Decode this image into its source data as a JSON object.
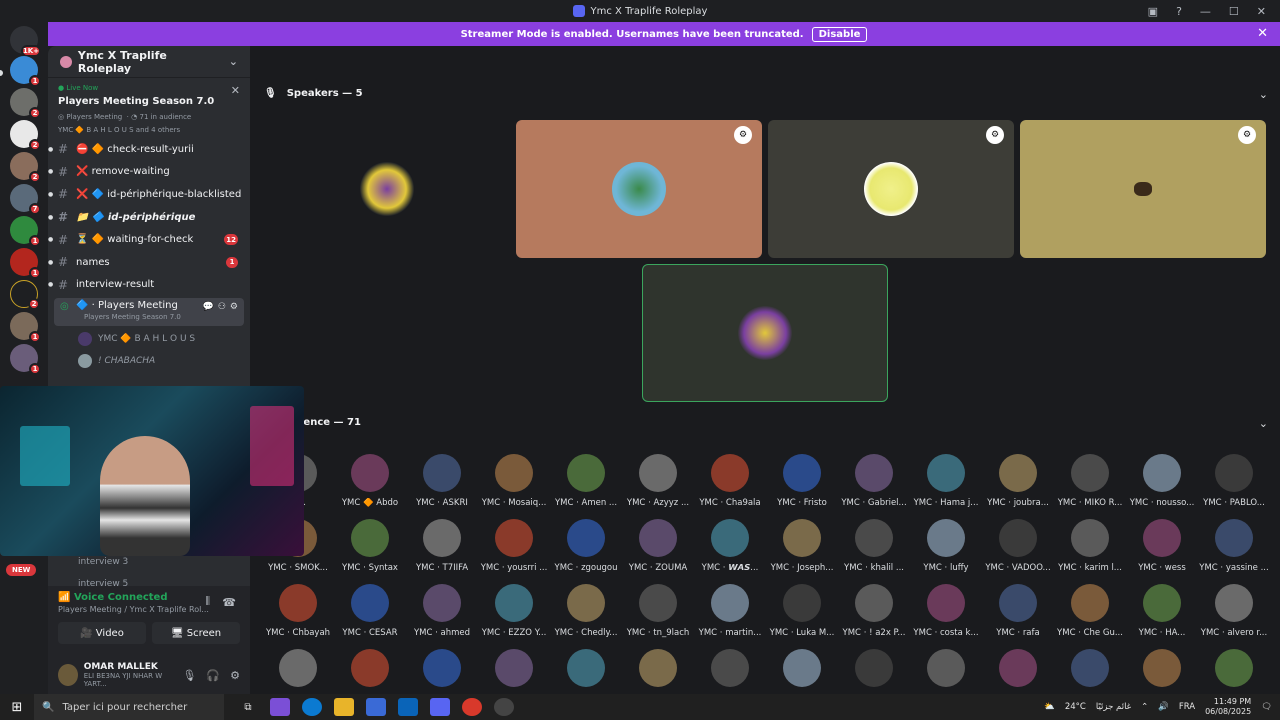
{
  "window": {
    "title": "Ymc X Traplife Roleplay"
  },
  "banner": {
    "text": "Streamer Mode is enabled. Usernames have been truncated.",
    "button": "Disable"
  },
  "rail": {
    "top_badge": "1K+",
    "server_badges": [
      "1",
      "2",
      "2",
      "2",
      "7",
      "1",
      "1",
      "2",
      "1",
      "1"
    ]
  },
  "server": {
    "name": "Ymc X Traplife Roleplay"
  },
  "live_event": {
    "status": "Live Now",
    "title": "Players Meeting Season 7.0",
    "channel": "Players Meeting",
    "audience": "71 in audience",
    "speakers": "YMC 🔶 B A H L O U S and 4 others"
  },
  "channels": [
    {
      "name": "⛔ 🔶 check-result-yurii",
      "count": ""
    },
    {
      "name": "❌ remove-waiting",
      "count": ""
    },
    {
      "name": "❌ 🔷 id-périphérique-blacklisted",
      "count": ""
    },
    {
      "name": "📁 🔷 id-périphérique",
      "count": ""
    },
    {
      "name": "⏳ 🔶 waiting-for-check",
      "count": "12"
    },
    {
      "name": "names",
      "count": "1"
    },
    {
      "name": "interview-result",
      "count": ""
    }
  ],
  "voice_channel": {
    "name": "Players Meeting",
    "sub": "Players Meeting Season 7.0"
  },
  "voice_users": [
    "YMC 🔶 B A H L O U S",
    "! CHABACHA"
  ],
  "hidden_channels": [
    "interview 3",
    "interview 5"
  ],
  "new_badge": "NEW",
  "voice_panel": {
    "status": "Voice Connected",
    "location": "Players Meeting / Ymc X Traplife Rol...",
    "video": "Video",
    "screen": "Screen"
  },
  "user": {
    "name": "OMAR MALLEK",
    "status": "ELI BE3NA YJI NHAR W YART..."
  },
  "stage": {
    "speakers_header": "Speakers — 5",
    "audience_header": "ience — 71",
    "tile_colors": [
      "#242627",
      "#b67a5e",
      "#3d3d37",
      "#b0a060",
      "#2f342d"
    ]
  },
  "audience": [
    [
      "nj...",
      "YMC 🔶 Abdo",
      "YMC · ASKRI",
      "YMC · Mosaiq...",
      "YMC · Amen ...",
      "YMC · Azyyz ...",
      "YMC · Cha9ala",
      "YMC · Fristo",
      "YMC · Gabriel...",
      "YMC · Hama j...",
      "YMC · joubra...",
      "YMC · MIKO R...",
      "YMC · nousso...",
      "YMC · PABLO..."
    ],
    [
      "YMC · SMOK...",
      "YMC · Syntax",
      "YMC · T7IIFA",
      "YMC · yousrri ...",
      "YMC · zgougou",
      "YMC · ZOUMA",
      "YMC · 𝙒𝘼𝙎...",
      "YMC · Joseph...",
      "YMC · khalil ...",
      "YMC · luffy",
      "YMC · VADOO...",
      "YMC · karim l...",
      "YMC · wess",
      "YMC · yassine ..."
    ],
    [
      "YMC · Chbayah",
      "YMC · CESAR",
      "YMC · ahmed",
      "YMC · EZZO Y...",
      "YMC · Chedly...",
      "YMC · tn_9lach",
      "YMC · martin...",
      "YMC · Luka M...",
      "YMC · ! a2x P...",
      "YMC · costa k...",
      "YMC · rafa",
      "YMC · Che Gu...",
      "YMC · HA...",
      "YMC · alvero r..."
    ]
  ],
  "taskbar": {
    "search": "Taper ici pour rechercher",
    "weather": "24°C",
    "weather_text": "غائم جزئيًا",
    "lang": "FRA",
    "time": "11:49 PM",
    "date": "06/08/2025"
  }
}
